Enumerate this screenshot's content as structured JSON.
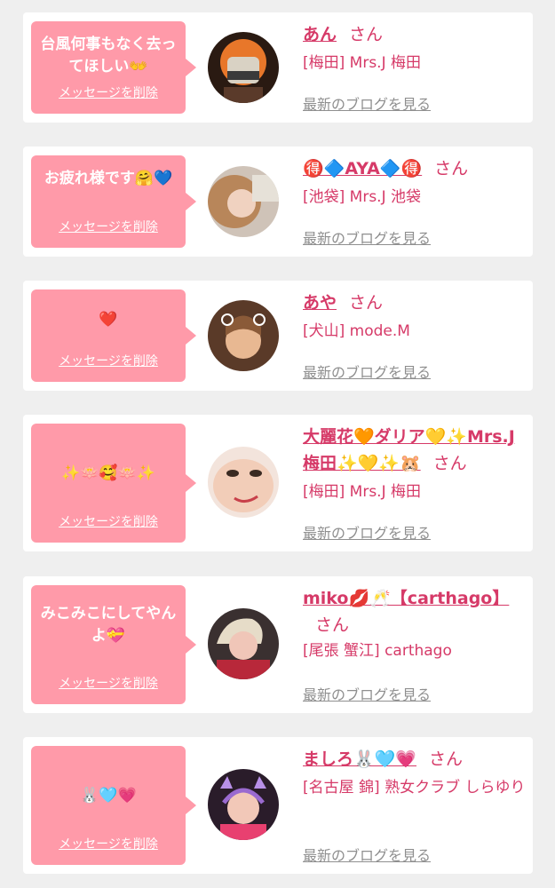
{
  "delete_label": "メッセージを削除",
  "blog_label": "最新のブログを見る",
  "honorific": "さん",
  "cards": [
    {
      "message": "台風何事もなく去ってほしい👐",
      "name": "あん",
      "shop": "[梅田] Mrs.J 梅田"
    },
    {
      "message": "お疲れ様です🤗💙",
      "name": "🉐🔷AYA🔷🉐",
      "shop": "[池袋] Mrs.J 池袋"
    },
    {
      "message": "❤️",
      "name": "あや",
      "shop": "[犬山] mode.M"
    },
    {
      "message": "✨🪷🥰🪷✨",
      "name": "大麗花🧡ダリア💛✨Mrs.J 梅田✨💛✨🐹",
      "shop": "[梅田] Mrs.J 梅田"
    },
    {
      "message": "みこみこにしてやんよ💝",
      "name": "miko💋🥂【carthago】",
      "shop": "[尾張 蟹江] carthago"
    },
    {
      "message": "🐰🩵💗",
      "name": "ましろ🐰🩵💗",
      "shop": "[名古屋 錦] 熟女クラブ しらゆり"
    }
  ],
  "colors": {
    "bubble": "#ff9aa9",
    "accent": "#d63a68",
    "link_gray": "#8f8f8f",
    "background": "#efefef"
  }
}
